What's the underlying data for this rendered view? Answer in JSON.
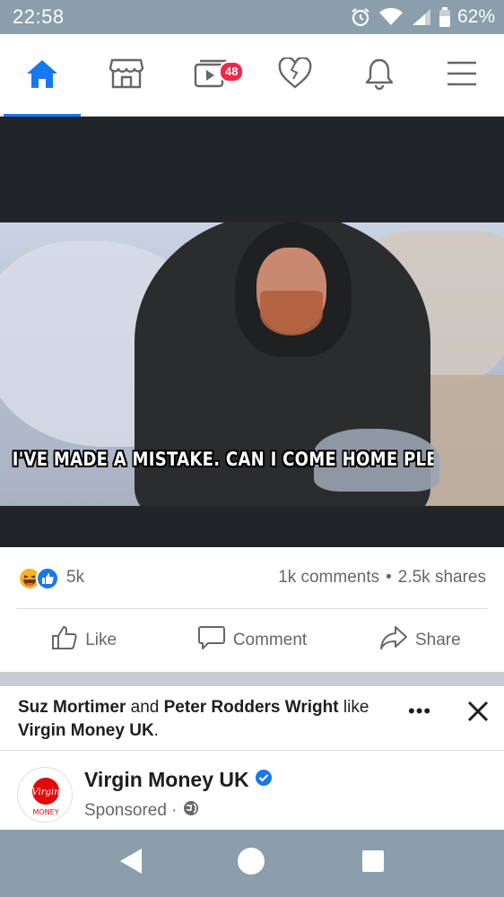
{
  "status_bar": {
    "time": "22:58",
    "battery": "62%"
  },
  "nav": {
    "items": [
      {
        "name": "home",
        "active": true
      },
      {
        "name": "marketplace"
      },
      {
        "name": "watch",
        "badge": "48"
      },
      {
        "name": "dating"
      },
      {
        "name": "notifications"
      },
      {
        "name": "menu"
      }
    ]
  },
  "post": {
    "caption": "I'VE MADE A MISTAKE. CAN I COME HOME PLEAS",
    "reaction_count": "5k",
    "comments": "1k comments",
    "dot": "•",
    "shares": "2.5k shares",
    "actions": {
      "like": "Like",
      "comment": "Comment",
      "share": "Share"
    }
  },
  "next_post": {
    "friend1": "Suz Mortimer",
    "and": "and",
    "friend2": "Peter Rodders Wright",
    "like_text": "like",
    "liked_page": "Virgin Money UK",
    "period": ".",
    "more": "•••",
    "page_name": "Virgin Money UK",
    "sponsored": "Sponsored ·",
    "logo_text_1": "Virgin",
    "logo_text_2": "MONEY"
  },
  "colors": {
    "accent": "#1877f2",
    "status_bar": "#8a9eab",
    "badge": "#f02849",
    "secondary_text": "#65676b"
  }
}
